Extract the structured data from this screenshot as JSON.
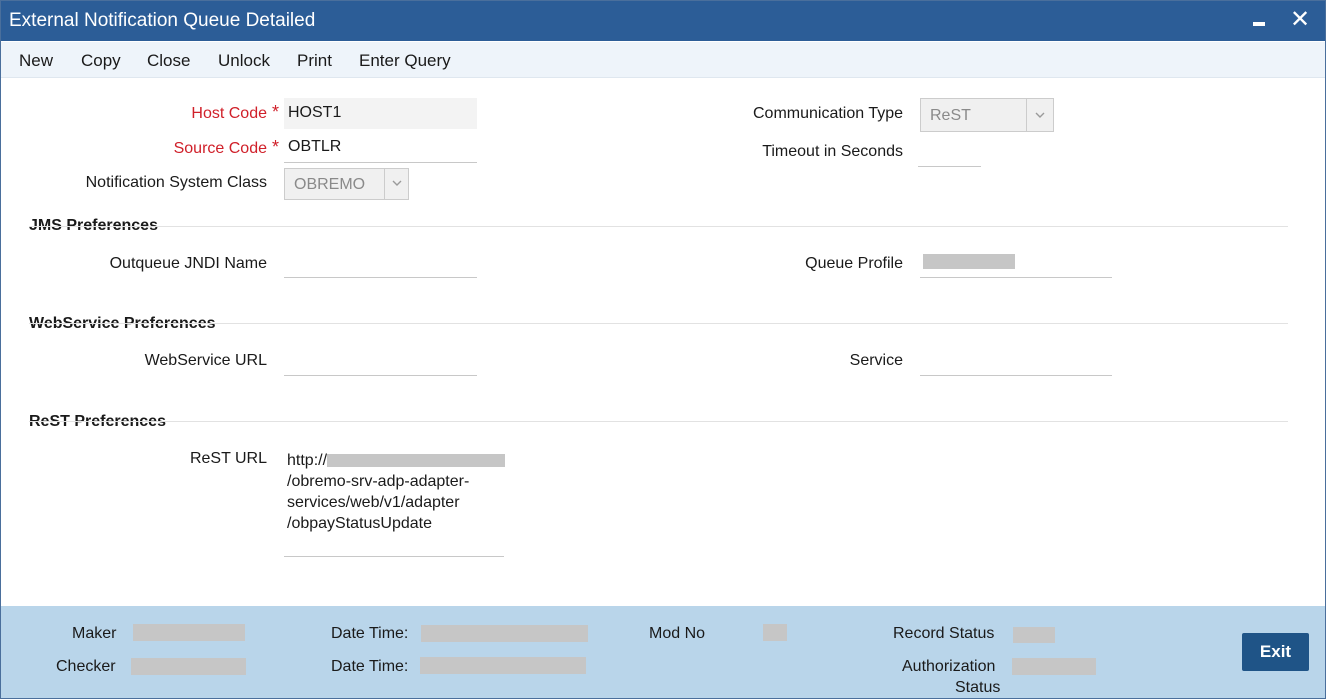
{
  "window": {
    "title": "External Notification Queue Detailed"
  },
  "toolbar": {
    "new_label": "New",
    "copy_label": "Copy",
    "close_label": "Close",
    "unlock_label": "Unlock",
    "print_label": "Print",
    "enter_query_label": "Enter Query"
  },
  "form": {
    "host_code": {
      "label": "Host Code",
      "required_mark": "*",
      "value": "HOST1"
    },
    "source_code": {
      "label": "Source Code",
      "required_mark": "*",
      "value": "OBTLR"
    },
    "notification_system_class": {
      "label": "Notification System Class",
      "value": "OBREMO"
    },
    "communication_type": {
      "label": "Communication Type",
      "value": "ReST"
    },
    "timeout_in_seconds": {
      "label": "Timeout in Seconds",
      "value": ""
    }
  },
  "jms": {
    "heading": "JMS Preferences",
    "outqueue_jndi_name": {
      "label": "Outqueue JNDI Name",
      "value": ""
    },
    "queue_profile": {
      "label": "Queue Profile",
      "value": ""
    }
  },
  "webservice": {
    "heading": "WebService Preferences",
    "url": {
      "label": "WebService URL",
      "value": ""
    },
    "service": {
      "label": "Service",
      "value": ""
    }
  },
  "rest": {
    "heading": "ReST Preferences",
    "url": {
      "label": "ReST URL",
      "line1": "http://",
      "line2": "/obremo-srv-adp-adapter-",
      "line3": "services/web/v1/adapter",
      "line4": "/obpayStatusUpdate"
    }
  },
  "footer": {
    "maker_label": "Maker",
    "checker_label": "Checker",
    "date_time_label_1": "Date Time:",
    "date_time_label_2": "Date Time:",
    "mod_no_label": "Mod No",
    "record_status_label": "Record Status",
    "authorization_status_label_1": "Authorization",
    "authorization_status_label_2": "Status",
    "exit_label": "Exit"
  },
  "colors": {
    "title_bar": "#2c5d97",
    "required": "#d0202a",
    "footer": "#b9d5ea",
    "exit_button": "#1f5487"
  }
}
